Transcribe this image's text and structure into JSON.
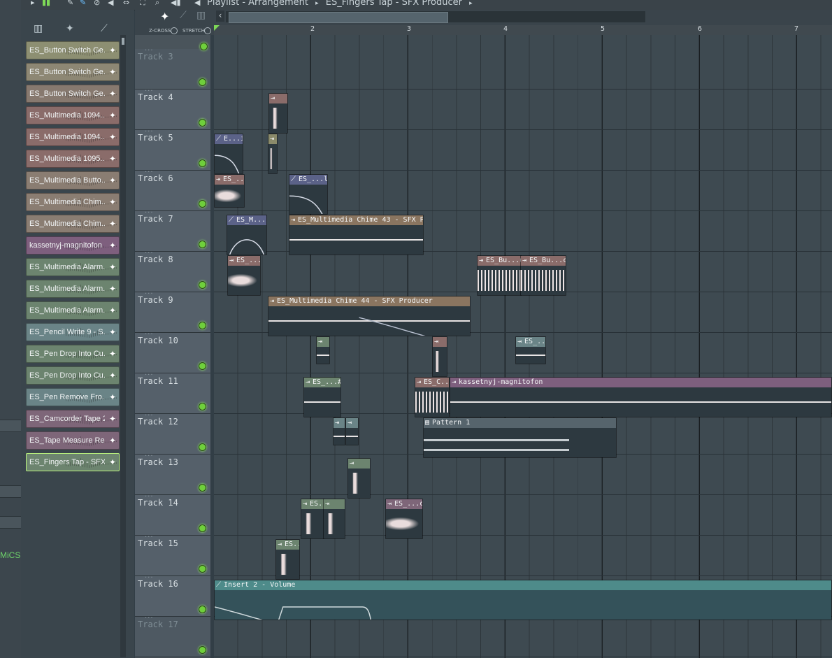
{
  "window": {
    "title": "Playlist - Arrangement",
    "breadcrumb": "ES_Fingers Tap - SFX Producer"
  },
  "browser": {
    "clips": [
      {
        "label": "ES_Button Switch Ge...",
        "color": "#8d8f72"
      },
      {
        "label": "ES_Button Switch Ge...",
        "color": "#8d8774"
      },
      {
        "label": "ES_Button Switch Ge...",
        "color": "#87796f"
      },
      {
        "label": "ES_Multimedia 1094...",
        "color": "#8a6c6a"
      },
      {
        "label": "ES_Multimedia 1094...",
        "color": "#8a6c6a"
      },
      {
        "label": "ES_Multimedia 1095...",
        "color": "#8a6c6a"
      },
      {
        "label": "ES_Multimedia Butto...",
        "color": "#8a7d72"
      },
      {
        "label": "ES_Multimedia Chim...",
        "color": "#8a7d72"
      },
      {
        "label": "ES_Multimedia Chim...",
        "color": "#8a7d72"
      },
      {
        "label": "kassetnyj-magnitofon",
        "color": "#7e5f7e"
      },
      {
        "label": "ES_Multimedia Alarm...",
        "color": "#6c846f"
      },
      {
        "label": "ES_Multimedia Alarm...",
        "color": "#6c846f"
      },
      {
        "label": "ES_Multimedia Alarm...",
        "color": "#6c846f"
      },
      {
        "label": "ES_Pencil Write 9 - S...",
        "color": "#6a8487"
      },
      {
        "label": "ES_Pen Drop Into Cu...",
        "color": "#6c846f"
      },
      {
        "label": "ES_Pen Drop Into Cu...",
        "color": "#6c846f"
      },
      {
        "label": "ES_Pen Remove Fro...",
        "color": "#6a8487"
      },
      {
        "label": "ES_Camcorder Tape 2...",
        "color": "#7e6679"
      },
      {
        "label": "ES_Tape Measure Re...",
        "color": "#7e6679"
      },
      {
        "label": "ES_Fingers Tap - SFX...",
        "color": "#6c846f"
      }
    ]
  },
  "playlist": {
    "labels": {
      "zcross": "Z-CROSS",
      "stretch": "STRETCH"
    },
    "bars": [
      "2",
      "3",
      "4",
      "5",
      "6",
      "7"
    ],
    "tracks": [
      "Track 3",
      "Track 4",
      "Track 5",
      "Track 6",
      "Track 7",
      "Track 8",
      "Track 9",
      "Track 10",
      "Track 11",
      "Track 12",
      "Track 13",
      "Track 14",
      "Track 15",
      "Track 16",
      "Track 17"
    ],
    "clips": [
      {
        "label": "",
        "color": "#8a6c6a"
      },
      {
        "label": "",
        "color": "#8a8a6a"
      },
      {
        "label": "E...ier",
        "color": "#5b6288"
      },
      {
        "label": "ES_...r",
        "color": "#8a6c6a"
      },
      {
        "label": "ES_...lier",
        "color": "#5b6288"
      },
      {
        "label": "ES_M...ier",
        "color": "#5b6288"
      },
      {
        "label": "ES_Multimedia Chime 43 - SFX Producer",
        "color": "#8a7560"
      },
      {
        "label": "ES_...2",
        "color": "#8a6c6a"
      },
      {
        "label": "ES_Bu...uce",
        "color": "#8a6c6a"
      },
      {
        "label": "ES_Bu...cer",
        "color": "#8a6c6a"
      },
      {
        "label": "ES_Multimedia Chime 44 - SFX Producer",
        "color": "#8a7560"
      },
      {
        "label": "",
        "color": "#6c846f"
      },
      {
        "label": "",
        "color": "#8a6c6a"
      },
      {
        "label": "ES_...r",
        "color": "#6a8487"
      },
      {
        "label": "ES_...#2",
        "color": "#6c846f"
      },
      {
        "label": "ES_C...",
        "color": "#8a6c6a"
      },
      {
        "label": "kassetnyj-magnitofon",
        "color": "#7e5f7e"
      },
      {
        "label": "",
        "color": "#6a8487"
      },
      {
        "label": "",
        "color": "#6a8487"
      },
      {
        "label": "Pattern 1",
        "color": "#56646c"
      },
      {
        "label": "",
        "color": "#6c846f"
      },
      {
        "label": "ES...",
        "color": "#6c846f"
      },
      {
        "label": "",
        "color": "#6c846f"
      },
      {
        "label": "ES_...cer",
        "color": "#7e6679"
      },
      {
        "label": "ES...",
        "color": "#6c846f"
      },
      {
        "label": "Insert 2 - Volume",
        "color": "#4e8b8a"
      }
    ]
  }
}
